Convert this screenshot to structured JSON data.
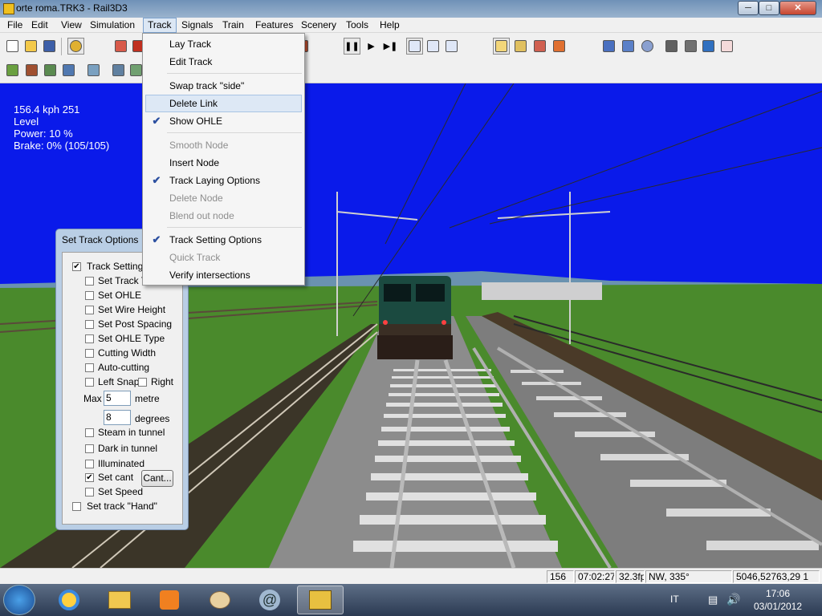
{
  "window": {
    "title": "orte roma.TRK3 - Rail3D3",
    "minimize": "─",
    "maximize": "□",
    "close": "✕"
  },
  "menubar": [
    "File",
    "Edit",
    "View",
    "Simulation",
    "Track",
    "Signals",
    "Train",
    "Features",
    "Scenery",
    "Tools",
    "Help"
  ],
  "track_menu": {
    "items": [
      {
        "label": "Lay Track",
        "checked": false,
        "enabled": true
      },
      {
        "label": "Edit Track",
        "checked": false,
        "enabled": true
      },
      {
        "label": "Swap track \"side\"",
        "checked": false,
        "enabled": true
      },
      {
        "label": "Delete Link",
        "checked": false,
        "enabled": true,
        "highlighted": true
      },
      {
        "label": "Show OHLE",
        "checked": true,
        "enabled": true
      },
      {
        "label": "Smooth Node",
        "checked": false,
        "enabled": false
      },
      {
        "label": "Insert Node",
        "checked": false,
        "enabled": true
      },
      {
        "label": "Track Laying Options",
        "checked": true,
        "enabled": true
      },
      {
        "label": "Delete Node",
        "checked": false,
        "enabled": false
      },
      {
        "label": "Blend out node",
        "checked": false,
        "enabled": false
      },
      {
        "label": "Track Setting Options",
        "checked": true,
        "enabled": true
      },
      {
        "label": "Quick Track",
        "checked": false,
        "enabled": false
      },
      {
        "label": "Verify intersections",
        "checked": false,
        "enabled": true
      }
    ],
    "check_glyph": "✔"
  },
  "hud": {
    "speed": "156.4 kph 251",
    "grade": "Level",
    "power": "Power: 10 %",
    "brake": "Brake:  0% (105/105)"
  },
  "set_track_options": {
    "title": "Set Track Options",
    "track_setting": {
      "label": "Track Setting (",
      "checked": true
    },
    "options": [
      {
        "label": "Set Track T",
        "checked": false
      },
      {
        "label": "Set OHLE",
        "checked": false
      },
      {
        "label": "Set Wire Height",
        "checked": false
      },
      {
        "label": "Set Post Spacing",
        "checked": false
      },
      {
        "label": "Set OHLE Type",
        "checked": false
      },
      {
        "label": "Cutting Width",
        "checked": false
      },
      {
        "label": "Auto-cutting",
        "checked": false
      }
    ],
    "left_snap": {
      "label": "Left Snap",
      "checked": false
    },
    "right": {
      "label": "Right",
      "checked": false
    },
    "max_label": "Max",
    "max_value": "5",
    "max_unit": "metre",
    "degrees_value": "8",
    "degrees_unit": "degrees",
    "options2": [
      {
        "label": "Steam in tunnel",
        "checked": false
      },
      {
        "label": "Dark in tunnel",
        "checked": false
      },
      {
        "label": "Illuminated",
        "checked": false
      }
    ],
    "set_cant": {
      "label": "Set cant",
      "checked": true
    },
    "cant_button": "Cant...",
    "set_speed": {
      "label": "Set Speed",
      "checked": false
    },
    "set_track_hand": {
      "label": "Set track \"Hand\"",
      "checked": false
    }
  },
  "statusbar": {
    "cell1": "156",
    "cell2": "07:02:27",
    "cell3": "32.3fp",
    "cell4": "NW, 335°",
    "cell5": "5046,52763,29 1"
  },
  "taskbar": {
    "language": "IT",
    "time": "17:06",
    "date": "03/01/2012"
  },
  "colors": {
    "sky": "#0a1aea",
    "grass": "#4a8a2c",
    "ballast": "#8d8d8d",
    "loco": "#1b4a40"
  }
}
